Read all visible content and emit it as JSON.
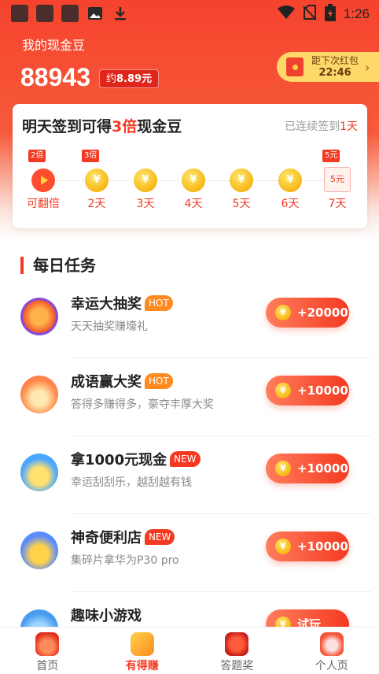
{
  "status_bar": {
    "time": "1:26"
  },
  "header": {
    "cash_label": "我的现金豆",
    "cash_amount": "88943",
    "approx_prefix": "约",
    "approx_value": "8.89元",
    "next_redpacket_label": "距下次红包",
    "next_redpacket_time": "22:46"
  },
  "signin": {
    "title_prefix": "明天签到可得",
    "title_highlight": "3倍",
    "title_suffix": "现金豆",
    "streak_prefix": "已连续签到",
    "streak_days": "1天",
    "days": [
      {
        "tag": "2倍",
        "label": "可翻倍",
        "kind": "play"
      },
      {
        "tag": "3倍",
        "label": "2天",
        "kind": "coin"
      },
      {
        "tag": "",
        "label": "3天",
        "kind": "coin"
      },
      {
        "tag": "",
        "label": "4天",
        "kind": "coin"
      },
      {
        "tag": "",
        "label": "5天",
        "kind": "coin"
      },
      {
        "tag": "",
        "label": "6天",
        "kind": "coin"
      },
      {
        "tag": "5元",
        "label": "7天",
        "kind": "envelope",
        "envelope_text": "5元"
      }
    ]
  },
  "tasks_section": {
    "title": "每日任务",
    "items": [
      {
        "name": "幸运大抽奖",
        "badge": "HOT",
        "badge_kind": "hot",
        "desc": "天天抽奖赚壕礼",
        "reward": "+20000",
        "icon": "lucky-wheel-icon"
      },
      {
        "name": "成语赢大奖",
        "badge": "HOT",
        "badge_kind": "hot",
        "desc": "答得多赚得多，豪夺丰厚大奖",
        "reward": "+10000",
        "icon": "idiom-book-icon"
      },
      {
        "name": "拿1000元现金",
        "badge": "NEW",
        "badge_kind": "new",
        "desc": "幸运刮刮乐，越刮越有钱",
        "reward": "+10000",
        "icon": "scratch-card-icon"
      },
      {
        "name": "神奇便利店",
        "badge": "NEW",
        "badge_kind": "new",
        "desc": "集碎片拿华为P30 pro",
        "reward": "+10000",
        "icon": "store-icon"
      },
      {
        "name": "趣味小游戏",
        "badge": "",
        "badge_kind": "",
        "desc": "",
        "reward": "试玩",
        "icon": "game-icon"
      }
    ]
  },
  "tabbar": {
    "tabs": [
      {
        "label": "首页",
        "active": false
      },
      {
        "label": "有得赚",
        "active": true
      },
      {
        "label": "答题奖",
        "active": false
      },
      {
        "label": "个人页",
        "active": false
      }
    ]
  },
  "colors": {
    "brand_red": "#f43a22",
    "hot_orange": "#ff8a1f",
    "coin_gold": "#f7b817"
  }
}
